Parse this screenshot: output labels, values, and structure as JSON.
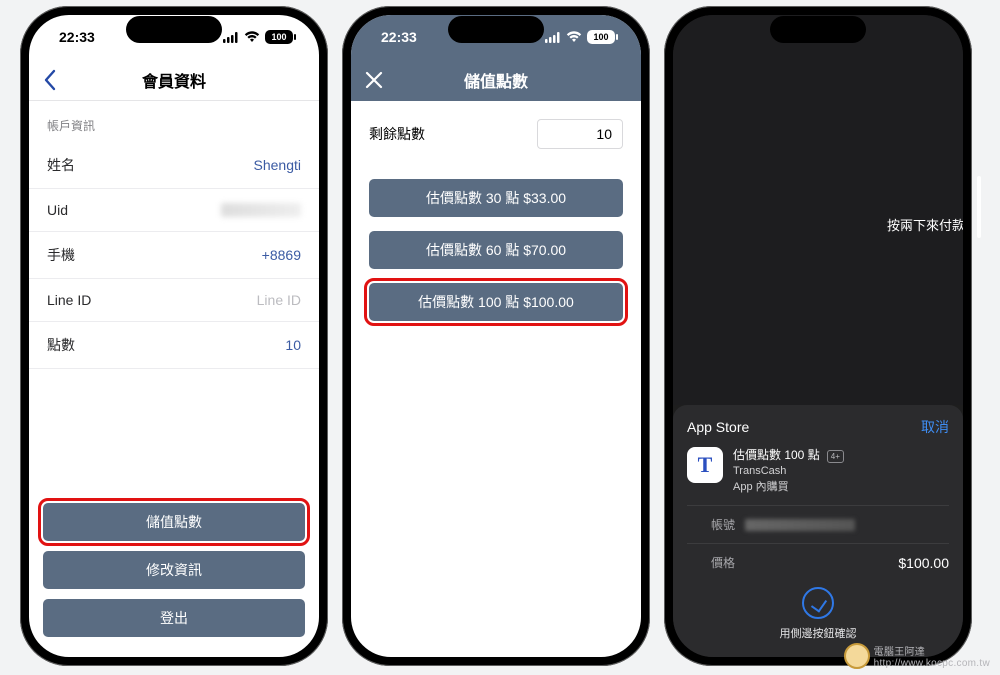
{
  "status": {
    "time": "22:33",
    "battery": "100"
  },
  "phone1": {
    "title": "會員資料",
    "section": "帳戶資訊",
    "rows": {
      "name": {
        "label": "姓名",
        "value": "Shengti"
      },
      "uid": {
        "label": "Uid",
        "value": ""
      },
      "mobile": {
        "label": "手機",
        "value": "+8869"
      },
      "line": {
        "label": "Line ID",
        "value": "Line ID"
      },
      "points": {
        "label": "點數",
        "value": "10"
      }
    },
    "actions": {
      "topup": "儲值點數",
      "edit": "修改資訊",
      "logout": "登出"
    }
  },
  "phone2": {
    "title": "儲值點數",
    "remaining_label": "剩餘點數",
    "remaining_value": "10",
    "options": [
      "估價點數 30 點 $33.00",
      "估價點數 60 點 $70.00",
      "估價點數 100 點 $100.00"
    ]
  },
  "phone3": {
    "side_hint": "按兩下來付款",
    "store": "App Store",
    "cancel": "取消",
    "product_title": "估價點數 100 點",
    "age": "4+",
    "product_app": "TransCash",
    "product_sub": "App 內購買",
    "account_label": "帳號",
    "price_label": "價格",
    "price_value": "$100.00",
    "confirm": "用側邊按鈕確認"
  },
  "watermark": {
    "text": "電腦王阿達",
    "url": "http://www.kocpc.com.tw"
  }
}
